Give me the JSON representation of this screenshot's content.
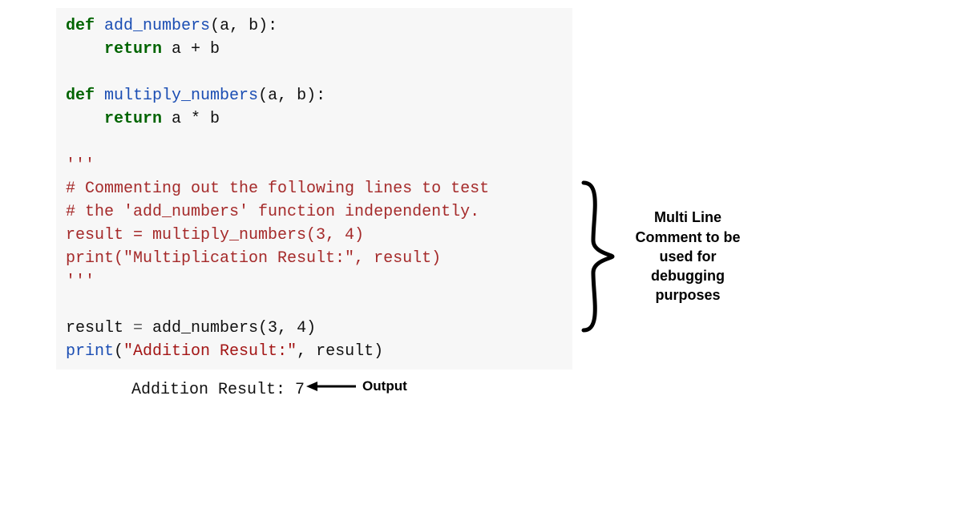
{
  "code": {
    "l1_def": "def",
    "l1_fn": "add_numbers",
    "l1_params": "(a, b):",
    "l2_ret": "    return",
    "l2_expr": " a + b",
    "blank1": "",
    "l4_def": "def",
    "l4_fn": "multiply_numbers",
    "l4_params": "(a, b):",
    "l5_ret": "    return",
    "l5_expr": " a * b",
    "blank2": "",
    "l7_tq": "'''",
    "l8_cmt": "# Commenting out the following lines to test",
    "l9_cmt": "# the 'add_numbers' function independently.",
    "l10_stmt": "result = multiply_numbers(3, 4)",
    "l11_stmt": "print(\"Multiplication Result:\", result)",
    "l12_tq": "'''",
    "blank3": "",
    "l14_lhs": "result ",
    "l14_eq": "=",
    "l14_rhs": " add_numbers(3, 4)",
    "l15_print": "print",
    "l15_paren1": "(",
    "l15_str": "\"Addition Result:\"",
    "l15_rest": ", result)"
  },
  "output": {
    "text": "Addition Result: 7",
    "label": "Output"
  },
  "annotation": {
    "line1": "Multi Line",
    "line2": "Comment to be",
    "line3": "used for",
    "line4": "debugging",
    "line5": "purposes"
  }
}
